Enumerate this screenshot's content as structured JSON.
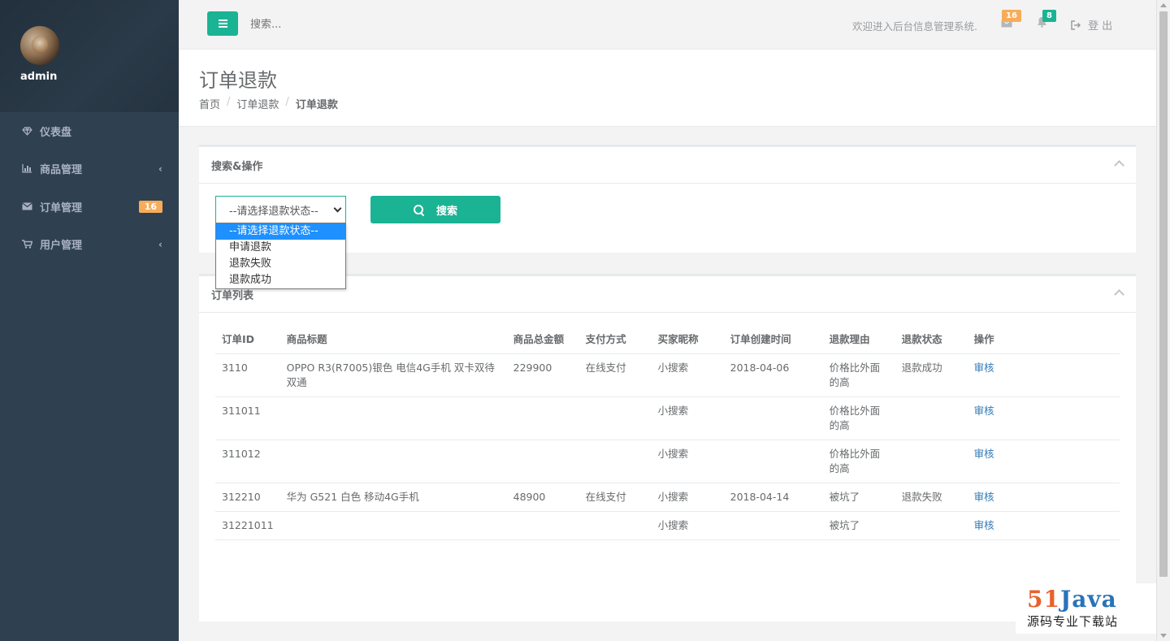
{
  "sidebar": {
    "username": "admin",
    "items": [
      {
        "label": "仪表盘",
        "icon": "diamond-icon"
      },
      {
        "label": "商品管理",
        "icon": "bar-chart-icon"
      },
      {
        "label": "订单管理",
        "icon": "envelope-icon",
        "badge": "16"
      },
      {
        "label": "用户管理",
        "icon": "cart-icon"
      }
    ]
  },
  "topbar": {
    "search_placeholder": "搜索...",
    "welcome": "欢迎进入后台信息管理系统.",
    "mail_count": "16",
    "bell_count": "8",
    "logout": "登 出"
  },
  "heading": {
    "title": "订单退款",
    "breadcrumb": [
      "首页",
      "订单退款",
      "订单退款"
    ]
  },
  "search_panel": {
    "title": "搜索&操作",
    "select_value": "--请选择退款状态--",
    "search_button": "搜索",
    "options": [
      "--请选择退款状态--",
      "申请退款",
      "退款失败",
      "退款成功"
    ]
  },
  "list_panel": {
    "title": "订单列表",
    "columns": [
      "订单ID",
      "商品标题",
      "商品总金额",
      "支付方式",
      "买家昵称",
      "订单创建时间",
      "退款理由",
      "退款状态",
      "操作"
    ],
    "rows": [
      [
        "3110",
        "OPPO R3(R7005)银色 电信4G手机 双卡双待双通",
        "229900",
        "在线支付",
        "小搜索",
        "2018-04-06",
        "价格比外面的高",
        "退款成功",
        "审核"
      ],
      [
        "311011",
        "",
        "",
        "",
        "小搜索",
        "",
        "价格比外面的高",
        "",
        "审核"
      ],
      [
        "311012",
        "",
        "",
        "",
        "小搜索",
        "",
        "价格比外面的高",
        "",
        "审核"
      ],
      [
        "312210",
        "华为 G521 白色 移动4G手机",
        "48900",
        "在线支付",
        "小搜索",
        "2018-04-14",
        "被坑了",
        "退款失败",
        "审核"
      ],
      [
        "31221011",
        "",
        "",
        "",
        "小搜索",
        "",
        "被坑了",
        "",
        "审核"
      ]
    ]
  },
  "watermark": {
    "num": "51",
    "word": "Java",
    "tagline": "源码专业下载站"
  },
  "colors": {
    "accent": "#1ab394",
    "sidebar": "#2f4050",
    "badge_orange": "#f8ac59",
    "link": "#337ab7"
  }
}
